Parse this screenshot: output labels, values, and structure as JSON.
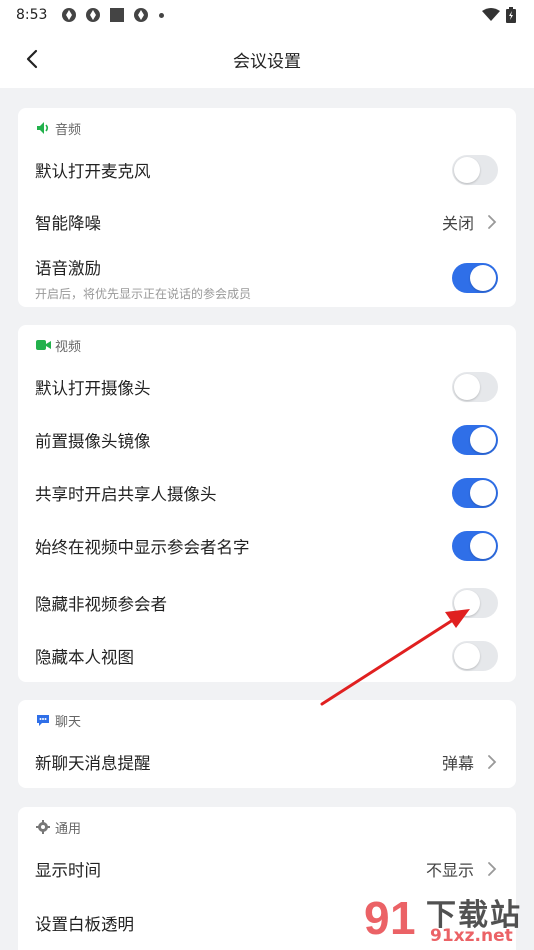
{
  "status_bar": {
    "time": "8:53"
  },
  "header": {
    "title": "会议设置"
  },
  "sections": {
    "audio": {
      "title": "音频",
      "rows": [
        {
          "label": "默认打开麦克风",
          "state": "off"
        },
        {
          "label": "智能降噪",
          "value": "关闭"
        },
        {
          "label": "语音激励",
          "sub": "开启后，将优先显示正在说话的参会成员",
          "state": "on"
        }
      ]
    },
    "video": {
      "title": "视频",
      "rows": [
        {
          "label": "默认打开摄像头",
          "state": "off"
        },
        {
          "label": "前置摄像头镜像",
          "state": "on"
        },
        {
          "label": "共享时开启共享人摄像头",
          "state": "on"
        },
        {
          "label": "始终在视频中显示参会者名字",
          "state": "on"
        },
        {
          "label": "隐藏非视频参会者",
          "state": "off"
        },
        {
          "label": "隐藏本人视图",
          "state": "off"
        }
      ]
    },
    "chat": {
      "title": "聊天",
      "rows": [
        {
          "label": "新聊天消息提醒",
          "value": "弹幕"
        }
      ]
    },
    "general": {
      "title": "通用",
      "rows": [
        {
          "label": "显示时间",
          "value": "不显示"
        },
        {
          "label": "设置白板透明"
        }
      ]
    }
  },
  "watermark": {
    "text": "下载站",
    "url": "91xz.net"
  },
  "colors": {
    "accent": "#2f6fe8",
    "green": "#22b14c",
    "arrow": "#e02020"
  }
}
